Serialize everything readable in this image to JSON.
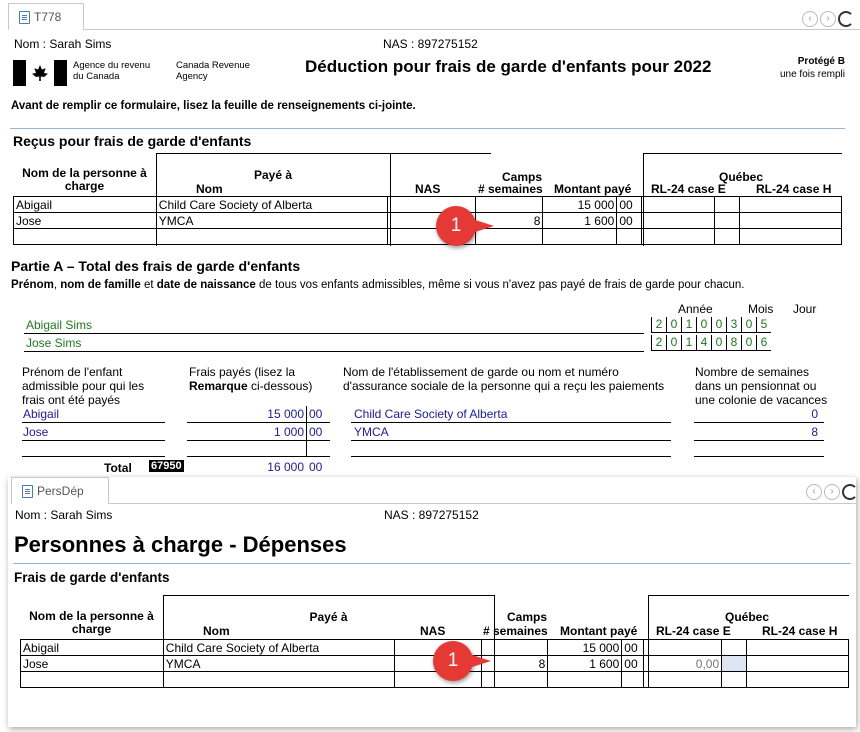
{
  "top": {
    "tab_label": "T778",
    "taxpayer_name": "Nom : Sarah Sims",
    "sin": "NAS : 897275152",
    "agency_fr": "Agence du revenu du Canada",
    "agency_en": "Canada Revenue Agency",
    "form_title": "Déduction pour frais de garde d'enfants pour 2022",
    "protected": "Protégé B",
    "protected_sub": "une fois rempli",
    "instruction": "Avant de remplir ce formulaire, lisez la feuille de renseignements ci-jointe.",
    "receipts_title": "Reçus pour frais de garde d'enfants",
    "receipts_headers": {
      "dependent": "Nom de la personne à charge",
      "paid_to": "Payé à",
      "name": "Nom",
      "nas": "NAS",
      "camps": "Camps",
      "weeks": "# semaines",
      "amount": "Montant payé",
      "quebec": "Québec",
      "rl_e": "RL-24 case E",
      "rl_h": "RL-24 case H"
    },
    "receipts_rows": [
      {
        "dependent": "Abigail",
        "name": "Child Care Society of Alberta",
        "weeks": "",
        "amount": "15 000",
        "cents": "00"
      },
      {
        "dependent": "Jose",
        "name": "YMCA",
        "weeks": "8",
        "amount": "1 600",
        "cents": "00"
      }
    ],
    "callout": "1",
    "part_a_title": "Partie A – Total des frais de garde d'enfants",
    "part_a_desc_1": "Prénom",
    "part_a_desc_2": ", ",
    "part_a_desc_3": "nom de famille",
    "part_a_desc_4": " et ",
    "part_a_desc_5": "date de naissance",
    "part_a_desc_6": " de tous vos enfants admissibles, même si vous n'avez pas payé de frais de garde pour chacun.",
    "date_headers": {
      "year": "Année",
      "month": "Mois",
      "day": "Jour"
    },
    "children": [
      {
        "name": "Abigail Sims",
        "date": [
          "2",
          "0",
          "1",
          "0",
          "0",
          "3",
          "0",
          "5"
        ]
      },
      {
        "name": "Jose Sims",
        "date": [
          "2",
          "0",
          "1",
          "4",
          "0",
          "8",
          "0",
          "6"
        ]
      }
    ],
    "col_child": "Prénom de l'enfant admissible pour qui les frais ont été payés",
    "col_fees_1": "Frais payés (lisez la",
    "col_fees_2": "Remarque",
    "col_fees_3": " ci-dessous)",
    "col_estab": "Nom de l'établissement de garde ou nom et numéro d'assurance sociale de la personne qui a reçu les paiements",
    "col_weeks": "Nombre de semaines dans un pensionnat ou une colonie de vacances",
    "part_a_rows": [
      {
        "child": "Abigail",
        "fees": "15 000",
        "cents": "00",
        "estab": "Child Care Society of Alberta",
        "weeks": "0"
      },
      {
        "child": "Jose",
        "fees": "1 000",
        "cents": "00",
        "estab": "YMCA",
        "weeks": "8"
      }
    ],
    "total_label": "Total",
    "total_code": "67950",
    "total_value": "16 000",
    "total_cents": "00"
  },
  "bottom": {
    "tab_label": "PersDép",
    "taxpayer_name": "Nom : Sarah Sims",
    "sin": "NAS : 897275152",
    "title": "Personnes à charge - Dépenses",
    "section": "Frais de garde d'enfants",
    "rows": [
      {
        "dependent": "Abigail",
        "name": "Child Care Society of Alberta",
        "weeks": "",
        "amount": "15 000",
        "cents": "00",
        "rl_e": ""
      },
      {
        "dependent": "Jose",
        "name": "YMCA",
        "weeks": "8",
        "amount": "1 600",
        "cents": "00",
        "rl_e": "0,00"
      }
    ],
    "callout": "1"
  },
  "colors": {
    "accent_red": "#e53935",
    "link_blue": "#1a1aa6",
    "green": "#1d7a1d"
  }
}
